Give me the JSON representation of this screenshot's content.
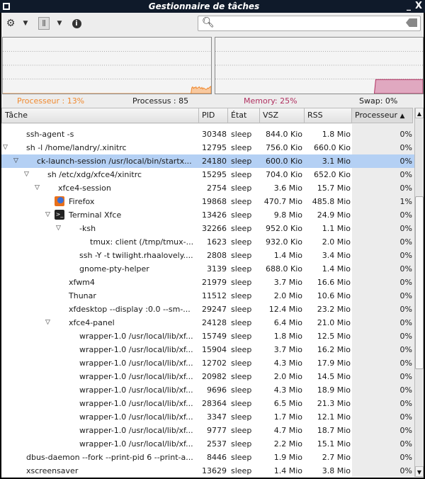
{
  "window": {
    "title": "Gestionnaire de tâches",
    "minimize": "_",
    "close": "X"
  },
  "toolbar": {
    "settings_icon": "gear-icon",
    "view_icon": "columns-icon",
    "info_icon": "info-icon",
    "search_placeholder": "",
    "search_value": ""
  },
  "stats": {
    "cpu": "Processeur : 13%",
    "processes": "Processus : 85",
    "memory": "Memory: 25%",
    "swap": "Swap: 0%",
    "cpu_color": "#f08a30",
    "mem_color": "#b03060"
  },
  "graphs": {
    "cpu_history": [
      0,
      0,
      0,
      0,
      0,
      0,
      0,
      0,
      0,
      0,
      0,
      0,
      0,
      0,
      0,
      0,
      0,
      0,
      0,
      0,
      0,
      0,
      0,
      0,
      0,
      0,
      0,
      0,
      0,
      0,
      0,
      0,
      0,
      0,
      0,
      0,
      0,
      0,
      0,
      0,
      0,
      0,
      0,
      0,
      0,
      0,
      0,
      0,
      0,
      0,
      0,
      0,
      0,
      0,
      0,
      0,
      0,
      0,
      0,
      0,
      0,
      0,
      0,
      0,
      0,
      0,
      0,
      0,
      0,
      0,
      0,
      0,
      0,
      0,
      0,
      0,
      0,
      0,
      0,
      0,
      0,
      0,
      0,
      0,
      0,
      0,
      0,
      0,
      0,
      0,
      0,
      0,
      0,
      0,
      0,
      0,
      0,
      0,
      0,
      0,
      0,
      0,
      0,
      0,
      0,
      0,
      0,
      0,
      0,
      0,
      0,
      0,
      0,
      0,
      0,
      0,
      0,
      0,
      0,
      0,
      0,
      0,
      0,
      0,
      0,
      0,
      0,
      0,
      0,
      0,
      0,
      0,
      0,
      0,
      0,
      0,
      0,
      0,
      0,
      0,
      0,
      0,
      0,
      0,
      0,
      0,
      0,
      0,
      0,
      0,
      0,
      0,
      0,
      0,
      0,
      0,
      0,
      0,
      0,
      0,
      0,
      0,
      0,
      0,
      0,
      0,
      0,
      0,
      0,
      0,
      0,
      0,
      0,
      0,
      0,
      0,
      0,
      0,
      0,
      0,
      0,
      0,
      0,
      0,
      0,
      0,
      0,
      0,
      0,
      0,
      0,
      0,
      0,
      0,
      0,
      0,
      0,
      0,
      0,
      0,
      0,
      0,
      0,
      0,
      0,
      0,
      0,
      0,
      0,
      0,
      0,
      0,
      0,
      0,
      0,
      0,
      0,
      0,
      0,
      0,
      0,
      0,
      0,
      0,
      0,
      10,
      12,
      9,
      11,
      10,
      12,
      9,
      10,
      11,
      12,
      10,
      9,
      11,
      8,
      10,
      9,
      8,
      7,
      8,
      10,
      9,
      11,
      12,
      13
    ],
    "mem_history_percent": 25
  },
  "columns": [
    {
      "label": "Tâche"
    },
    {
      "label": "PID"
    },
    {
      "label": "État"
    },
    {
      "label": "VSZ"
    },
    {
      "label": "RSS"
    },
    {
      "label": "Processeur",
      "sort": "▲"
    }
  ],
  "rows": [
    {
      "name": "ssh-agent -s",
      "pid": "30348",
      "state": "sleep",
      "vsz": "844.0 Kio",
      "rss": "1.8 Mio",
      "cpu": "0%",
      "level": 0
    },
    {
      "name": "sh -l /home/landry/.xinitrc",
      "pid": "12795",
      "state": "sleep",
      "vsz": "756.0 Kio",
      "rss": "660.0 Kio",
      "cpu": "0%",
      "level": 0,
      "expanded": true
    },
    {
      "name": "ck-launch-session /usr/local/bin/startx...",
      "pid": "24180",
      "state": "sleep",
      "vsz": "600.0 Kio",
      "rss": "3.1 Mio",
      "cpu": "0%",
      "level": 1,
      "expanded": true,
      "selected": true
    },
    {
      "name": "sh /etc/xdg/xfce4/xinitrc",
      "pid": "15295",
      "state": "sleep",
      "vsz": "704.0 Kio",
      "rss": "652.0 Kio",
      "cpu": "0%",
      "level": 2,
      "expanded": true
    },
    {
      "name": "xfce4-session",
      "pid": "2754",
      "state": "sleep",
      "vsz": "3.6 Mio",
      "rss": "15.7 Mio",
      "cpu": "0%",
      "level": 3,
      "expanded": true
    },
    {
      "name": "Firefox",
      "pid": "19868",
      "state": "sleep",
      "vsz": "470.7 Mio",
      "rss": "485.8 Mio",
      "cpu": "1%",
      "level": 4,
      "icon": "firefox-icon"
    },
    {
      "name": "Terminal Xfce",
      "pid": "13426",
      "state": "sleep",
      "vsz": "9.8 Mio",
      "rss": "24.9 Mio",
      "cpu": "0%",
      "level": 4,
      "icon": "terminal-icon",
      "expanded": true
    },
    {
      "name": "-ksh",
      "pid": "32266",
      "state": "sleep",
      "vsz": "952.0 Kio",
      "rss": "1.1 Mio",
      "cpu": "0%",
      "level": 5,
      "expanded": true
    },
    {
      "name": "tmux: client (/tmp/tmux-...",
      "pid": "1623",
      "state": "sleep",
      "vsz": "932.0 Kio",
      "rss": "2.0 Mio",
      "cpu": "0%",
      "level": 6
    },
    {
      "name": "ssh -Y -t twilight.rhaalovely....",
      "pid": "2808",
      "state": "sleep",
      "vsz": "1.4 Mio",
      "rss": "3.4 Mio",
      "cpu": "0%",
      "level": 5
    },
    {
      "name": "gnome-pty-helper",
      "pid": "3139",
      "state": "sleep",
      "vsz": "688.0 Kio",
      "rss": "1.4 Mio",
      "cpu": "0%",
      "level": 5
    },
    {
      "name": "xfwm4",
      "pid": "21979",
      "state": "sleep",
      "vsz": "3.7 Mio",
      "rss": "16.6 Mio",
      "cpu": "0%",
      "level": 4
    },
    {
      "name": "Thunar",
      "pid": "11512",
      "state": "sleep",
      "vsz": "2.0 Mio",
      "rss": "10.6 Mio",
      "cpu": "0%",
      "level": 4
    },
    {
      "name": "xfdesktop --display :0.0 --sm-...",
      "pid": "29247",
      "state": "sleep",
      "vsz": "12.4 Mio",
      "rss": "23.2 Mio",
      "cpu": "0%",
      "level": 4
    },
    {
      "name": "xfce4-panel",
      "pid": "24128",
      "state": "sleep",
      "vsz": "6.4 Mio",
      "rss": "21.0 Mio",
      "cpu": "0%",
      "level": 4,
      "expanded": true
    },
    {
      "name": "wrapper-1.0 /usr/local/lib/xf...",
      "pid": "15749",
      "state": "sleep",
      "vsz": "1.8 Mio",
      "rss": "12.5 Mio",
      "cpu": "0%",
      "level": 5
    },
    {
      "name": "wrapper-1.0 /usr/local/lib/xf...",
      "pid": "15904",
      "state": "sleep",
      "vsz": "3.7 Mio",
      "rss": "16.2 Mio",
      "cpu": "0%",
      "level": 5
    },
    {
      "name": "wrapper-1.0 /usr/local/lib/xf...",
      "pid": "12702",
      "state": "sleep",
      "vsz": "4.3 Mio",
      "rss": "17.9 Mio",
      "cpu": "0%",
      "level": 5
    },
    {
      "name": "wrapper-1.0 /usr/local/lib/xf...",
      "pid": "20982",
      "state": "sleep",
      "vsz": "2.0 Mio",
      "rss": "14.5 Mio",
      "cpu": "0%",
      "level": 5
    },
    {
      "name": "wrapper-1.0 /usr/local/lib/xf...",
      "pid": "9696",
      "state": "sleep",
      "vsz": "4.3 Mio",
      "rss": "18.9 Mio",
      "cpu": "0%",
      "level": 5
    },
    {
      "name": "wrapper-1.0 /usr/local/lib/xf...",
      "pid": "28364",
      "state": "sleep",
      "vsz": "6.5 Mio",
      "rss": "21.3 Mio",
      "cpu": "0%",
      "level": 5
    },
    {
      "name": "wrapper-1.0 /usr/local/lib/xf...",
      "pid": "3347",
      "state": "sleep",
      "vsz": "1.7 Mio",
      "rss": "12.1 Mio",
      "cpu": "0%",
      "level": 5
    },
    {
      "name": "wrapper-1.0 /usr/local/lib/xf...",
      "pid": "9777",
      "state": "sleep",
      "vsz": "4.7 Mio",
      "rss": "18.7 Mio",
      "cpu": "0%",
      "level": 5
    },
    {
      "name": "wrapper-1.0 /usr/local/lib/xf...",
      "pid": "2537",
      "state": "sleep",
      "vsz": "2.2 Mio",
      "rss": "15.1 Mio",
      "cpu": "0%",
      "level": 5
    },
    {
      "name": "dbus-daemon --fork --print-pid 6 --print-a...",
      "pid": "8446",
      "state": "sleep",
      "vsz": "1.9 Mio",
      "rss": "2.7 Mio",
      "cpu": "0%",
      "level": 0
    },
    {
      "name": "xscreensaver",
      "pid": "13629",
      "state": "sleep",
      "vsz": "1.4 Mio",
      "rss": "3.8 Mio",
      "cpu": "0%",
      "level": 0
    }
  ]
}
